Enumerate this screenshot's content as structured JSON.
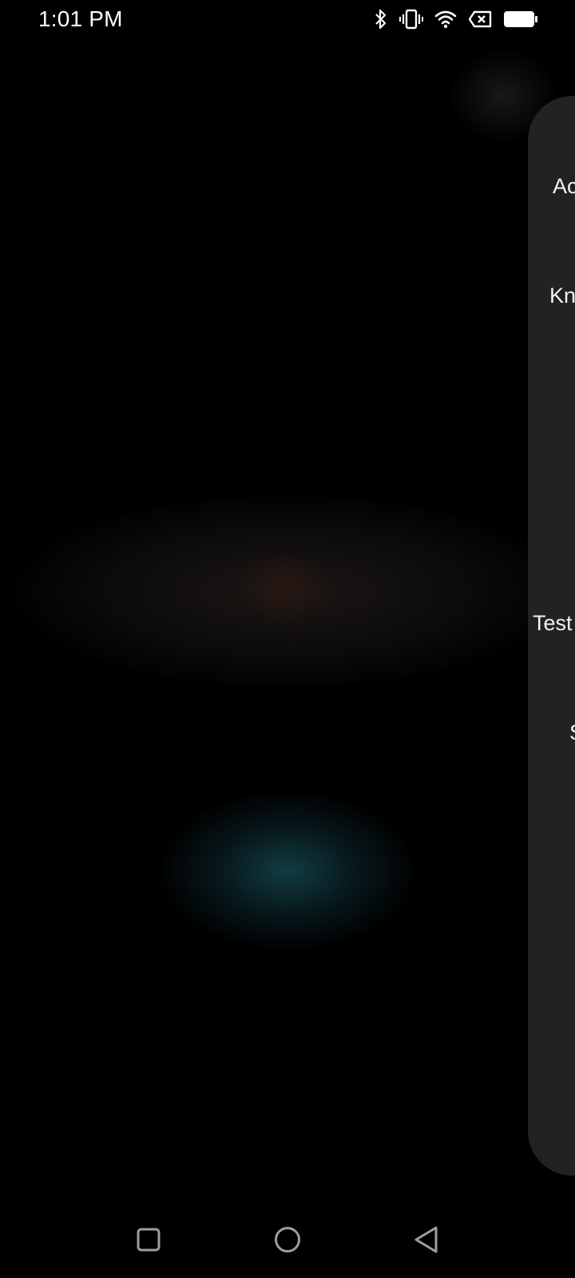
{
  "status_bar": {
    "time": "1:01 PM",
    "icons": [
      "bluetooth-icon",
      "vibrate-icon",
      "wifi-icon",
      "no-sim-icon",
      "battery-icon"
    ]
  },
  "side_panel": {
    "items": [
      {
        "label": "Ac"
      },
      {
        "label": "Kn"
      },
      {
        "label": "Test"
      },
      {
        "label": "S"
      }
    ]
  },
  "nav_bar": {
    "buttons": [
      "recents-icon",
      "home-icon",
      "back-icon"
    ]
  },
  "colors": {
    "background": "#000000",
    "panel": "#222222",
    "text": "#ffffff",
    "nav_icon": "#9e9e9e"
  }
}
